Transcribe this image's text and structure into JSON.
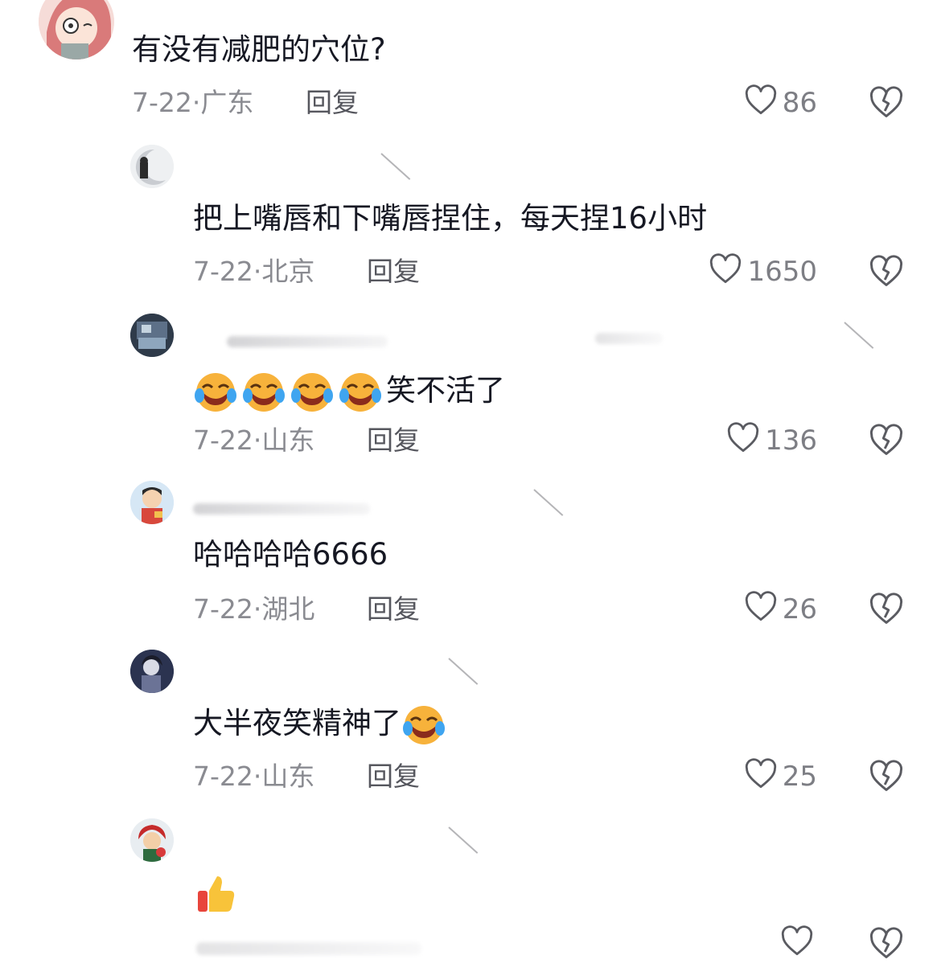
{
  "comments": [
    {
      "text": "有没有减肥的穴位?",
      "date_loc": "7-22·广东",
      "reply": "回复",
      "likes": "86"
    },
    {
      "text": "把上嘴唇和下嘴唇捏住，每天捏16小时",
      "date_loc": "7-22·北京",
      "reply": "回复",
      "likes": "1650"
    },
    {
      "text": "笑不活了",
      "date_loc": "7-22·山东",
      "reply": "回复",
      "likes": "136"
    },
    {
      "text": "哈哈哈哈6666",
      "date_loc": "7-22·湖北",
      "reply": "回复",
      "likes": "26"
    },
    {
      "text": "大半夜笑精神了",
      "date_loc": "7-22·山东",
      "reply": "回复",
      "likes": "25"
    },
    {
      "text": "",
      "date_loc": "",
      "reply": "",
      "likes": ""
    }
  ],
  "icons": {
    "like": "heart-outline-icon",
    "dislike": "broken-heart-icon",
    "emoji_laugh": "tears-of-joy-emoji",
    "emoji_thumb": "thumbs-up-emoji"
  },
  "colors": {
    "text": "#161823",
    "meta": "#8a8b91",
    "icon": "#5a5b61"
  }
}
